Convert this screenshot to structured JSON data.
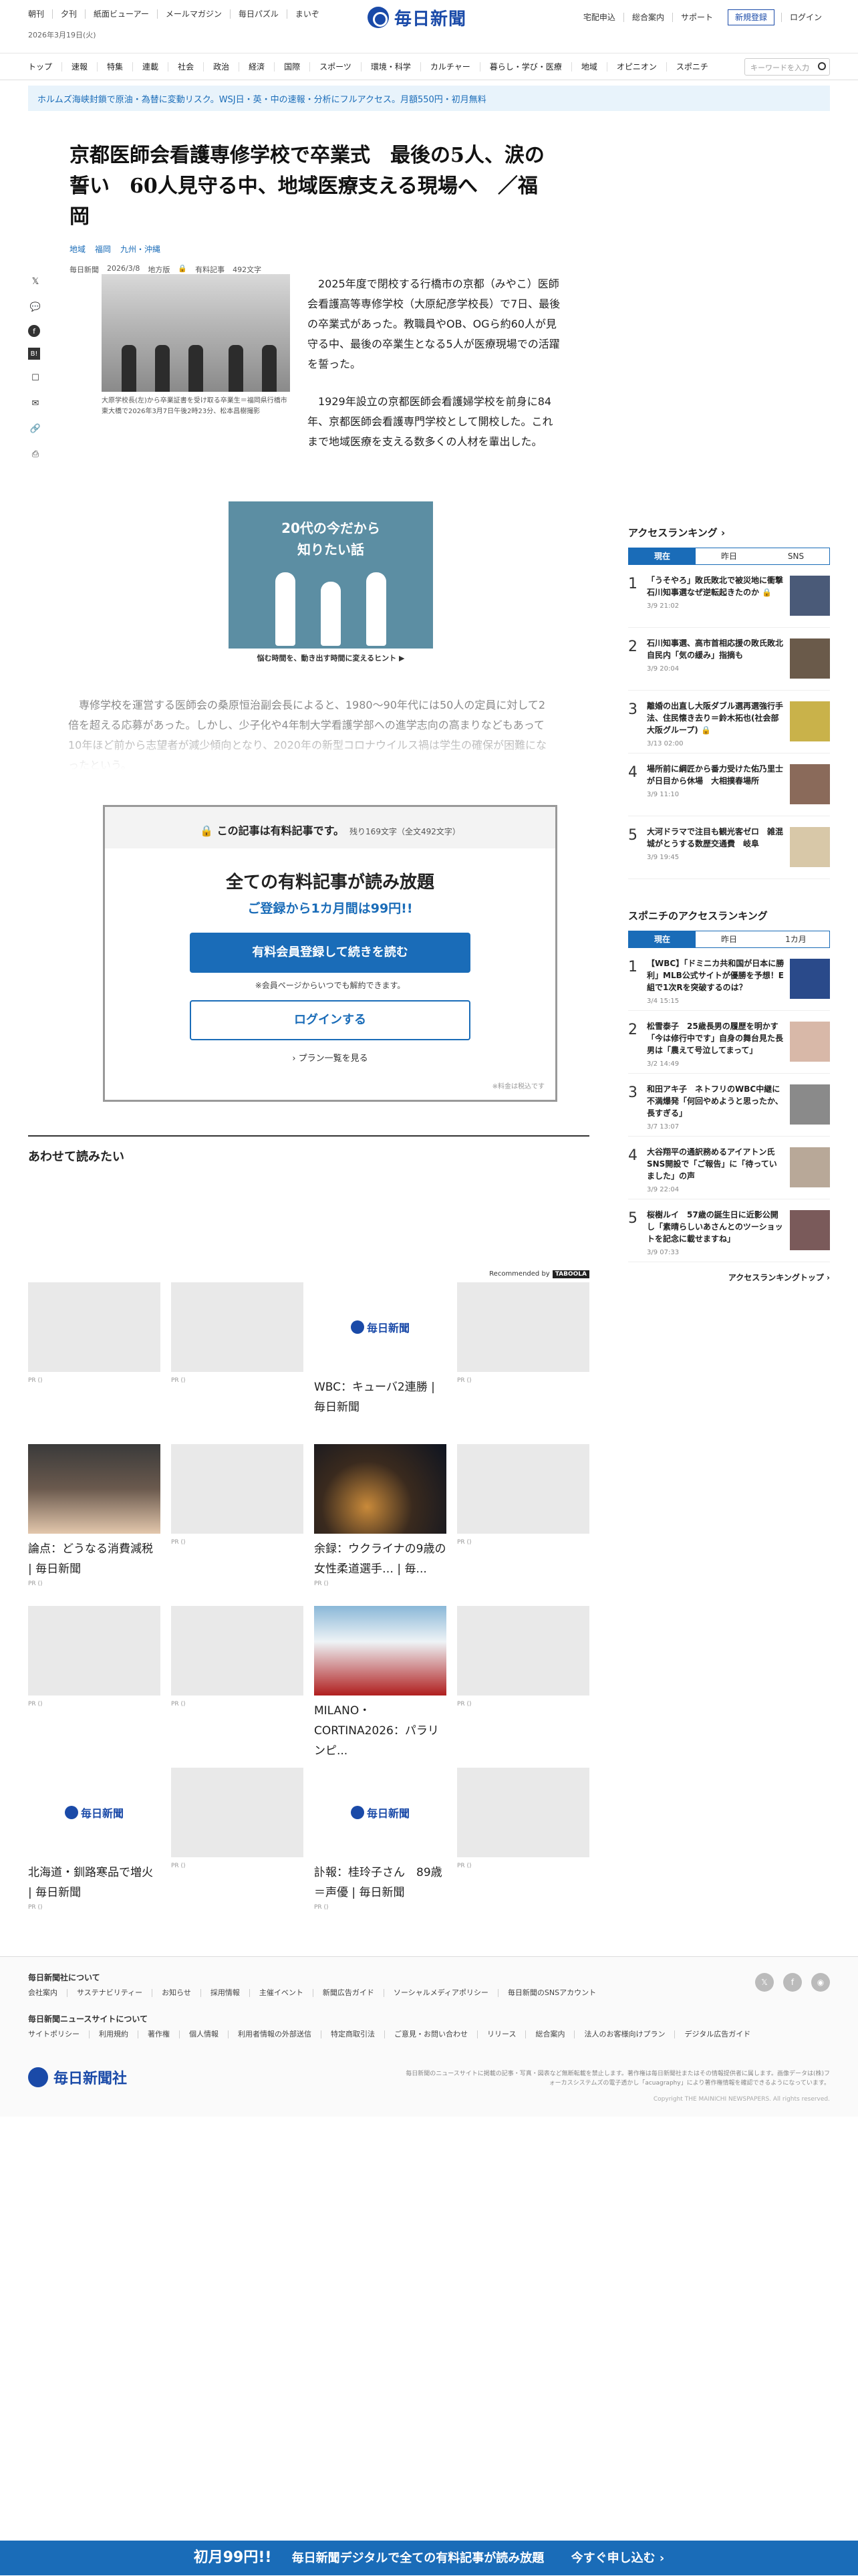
{
  "header": {
    "left_links": [
      "朝刊",
      "夕刊",
      "紙面ビューアー",
      "メールマガジン",
      "毎日パズル",
      "まいぞ"
    ],
    "date": "2026年3月19日(火)",
    "logo_text": "毎日新聞",
    "right_links": [
      "宅配申込",
      "総合案内",
      "サポート"
    ],
    "register": "新規登録",
    "login": "ログイン"
  },
  "nav": {
    "items": [
      "トップ",
      "速報",
      "特集",
      "連載",
      "社会",
      "政治",
      "経済",
      "国際",
      "スポーツ",
      "環境・科学",
      "カルチャー",
      "暮らし・学び・医療",
      "地域",
      "オピニオン",
      "スポニチ"
    ],
    "search_placeholder": "キーワードを入力"
  },
  "ticker": "ホルムズ海峡封鎖で原油・為替に変動リスク。WSJ日・英・中の速報・分析にフルアクセス。月額550円・初月無料",
  "article": {
    "title": "京都医師会看護専修学校で卒業式　最後の5人、涙の誓い　60人見守る中、地域医療支える現場へ　／福岡",
    "tags": [
      "地域",
      "福岡",
      "九州・沖縄"
    ],
    "meta": {
      "source": "毎日新聞",
      "date": "2026/3/8",
      "section": "地方版",
      "paid": "有料記事",
      "chars": "492文字"
    },
    "photo_caption": "大原学校長(左)から卒業証書を受け取る卒業生＝福岡県行橋市東大橋で2026年3月7日午後2時23分、松本昌樹撮影",
    "p1": "2025年度で閉校する行橋市の京都（みやこ）医師会看護高等専修学校（大原紀彦学校長）で7日、最後の卒業式があった。教職員やOB、OGら約60人が見守る中、最後の卒業生となる5人が医療現場での活躍を誓った。",
    "p2": "1929年設立の京都医師会看護婦学校を前身に84年、京都医師会看護専門学校として開校した。これまで地域医療を支える数多くの人材を輩出した。",
    "p3": "専修学校を運営する医師会の桑原恒治副会長によると、1980～90年代には50人の定員に対して2倍を超える応募があった。しかし、少子化や4年制大学看護学部への進学志向の高まりなどもあって10年ほど前から志望者が減少傾向となり、2020年の新型コロナウイルス禍は学生の確保が困難になったという。"
  },
  "ad": {
    "title_line1": "20代の今だから",
    "title_line2": "知りたい話",
    "cta": "悩む時間を、動き出す時間に変えるヒント ▶"
  },
  "paywall": {
    "header": "この記事は有料記事です。",
    "remain": "残り169文字（全文492文字）",
    "headline": "全ての有料記事が読み放題",
    "sub": "ご登録から1カ月間は99円!!",
    "btn_register": "有料会員登録して続きを読む",
    "note": "※会員ページからいつでも解約できます。",
    "btn_login": "ログインする",
    "plans": "› プラン一覧を見る",
    "tax": "※料金は税込です"
  },
  "related": {
    "title": "あわせて読みたい",
    "recommended_by": "Recommended by",
    "cards": [
      {
        "title": "",
        "pr": "PR ()",
        "kind": "blank"
      },
      {
        "title": "",
        "pr": "PR ()",
        "kind": "blank"
      },
      {
        "title": "WBC：キューバ2連勝 | 毎日新聞",
        "pr": "",
        "kind": "logo"
      },
      {
        "title": "",
        "pr": "PR ()",
        "kind": "blank"
      },
      {
        "title": "論点：どうなる消費減税 | 毎日新聞",
        "pr": "PR ()",
        "kind": "person"
      },
      {
        "title": "",
        "pr": "PR ()",
        "kind": "blank"
      },
      {
        "title": "余録：ウクライナの9歳の女性柔道選手… | 毎...",
        "pr": "PR ()",
        "kind": "night"
      },
      {
        "title": "",
        "pr": "PR ()",
        "kind": "blank"
      },
      {
        "title": "",
        "pr": "PR ()",
        "kind": "blank"
      },
      {
        "title": "",
        "pr": "PR ()",
        "kind": "blank"
      },
      {
        "title": "MILANO・CORTINA2026：パラリンピ...",
        "pr": "",
        "kind": "sport"
      },
      {
        "title": "",
        "pr": "PR ()",
        "kind": "blank"
      },
      {
        "title": "北海道・釧路寒品で増火 | 毎日新聞",
        "pr": "PR ()",
        "kind": "logo"
      },
      {
        "title": "",
        "pr": "PR ()",
        "kind": "blank"
      },
      {
        "title": "訃報：桂玲子さん　89歳＝声優 | 毎日新聞",
        "pr": "PR ()",
        "kind": "logo"
      },
      {
        "title": "",
        "pr": "PR ()",
        "kind": "blank"
      }
    ]
  },
  "sidebar": {
    "ranking_title": "アクセスランキング ›",
    "tabs": [
      "現在",
      "昨日",
      "SNS"
    ],
    "items": [
      {
        "rank": "1",
        "title": "「うそやろ」敗氏敗北で被災地に衝撃　石川知事選なぜ逆転起きたのか 🔒",
        "date": "3/9 21:02"
      },
      {
        "rank": "2",
        "title": "石川知事選、高市首相応援の敗氏敗北　自民内「気の緩み」指摘も",
        "date": "3/9 20:04"
      },
      {
        "rank": "3",
        "title": "離婚の出直し大阪ダブル選再選強行手法、住民懐き去り＝鈴木拓也(社会部大阪グループ) 🔒",
        "date": "3/13 02:00"
      },
      {
        "rank": "4",
        "title": "場所前に綱匠から番力受けた佑乃里士が日目から休場　大相撲春場所",
        "date": "3/9 11:10"
      },
      {
        "rank": "5",
        "title": "大河ドラマで注目も観光客ゼロ　雑混城がとうする数歴交通費　岐阜",
        "date": "3/9 19:45"
      }
    ],
    "sponichi_title": "スポニチのアクセスランキング",
    "sponichi_tabs": [
      "現在",
      "昨日",
      "1カ月"
    ],
    "sponichi_items": [
      {
        "rank": "1",
        "title": "【WBC】「ドミニカ共和国が日本に勝利」MLB公式サイトが優勝を予想！E組で1次Rを突破するのは？",
        "date": "3/4 15:15"
      },
      {
        "rank": "2",
        "title": "松雪泰子　25歳長男の履歴を明かす「今は修行中です」自身の舞台見た長男は「農えて号泣してまって」",
        "date": "3/2 14:49"
      },
      {
        "rank": "3",
        "title": "和田アキ子　ネトフリのWBC中継に不満爆発「何回やめようと思ったか、長すぎる」",
        "date": "3/7 13:07"
      },
      {
        "rank": "4",
        "title": "大谷翔平の通訳務めるアイアトン氏　SNS開設で「ご報告」に「待っていました」の声",
        "date": "3/9 22:04"
      },
      {
        "rank": "5",
        "title": "桜樹ルイ　57歳の誕生日に近影公開し「素晴らしいあさんとのツーショットを記念に載せますね」",
        "date": "3/9 07:33"
      }
    ],
    "more": "アクセスランキングトップ ›"
  },
  "footer": {
    "h1": "毎日新聞社について",
    "links1": [
      "会社案内",
      "サステナビリティー",
      "お知らせ",
      "採用情報",
      "主催イベント",
      "新聞広告ガイド",
      "ソーシャルメディアポリシー",
      "毎日新聞のSNSアカウント"
    ],
    "h2": "毎日新聞ニュースサイトについて",
    "links2": [
      "サイトポリシー",
      "利用規約",
      "著作権",
      "個人情報",
      "利用者情報の外部送信",
      "特定商取引法",
      "ご意見・お問い合わせ",
      "リリース",
      "総合案内",
      "法人のお客様向けプラン",
      "デジタル広告ガイド"
    ],
    "logo_text": "毎日新聞社",
    "note": "毎日新聞のニュースサイトに掲載の記事・写真・図表など無断転載を禁止します。著作権は毎日新聞社またはその情報提供者に属します。画像データは(株)フォーカスシステムズの電子透かし「acuagraphy」により著作権情報を確認できるようになっています。",
    "copyright": "Copyright THE MAINICHI NEWSPAPERS. All rights reserved."
  },
  "bottom_bar": {
    "a": "初月99円!!",
    "b": "毎日新聞デジタルで全ての有料記事が読み放題",
    "c": "今すぐ申し込む ›"
  }
}
